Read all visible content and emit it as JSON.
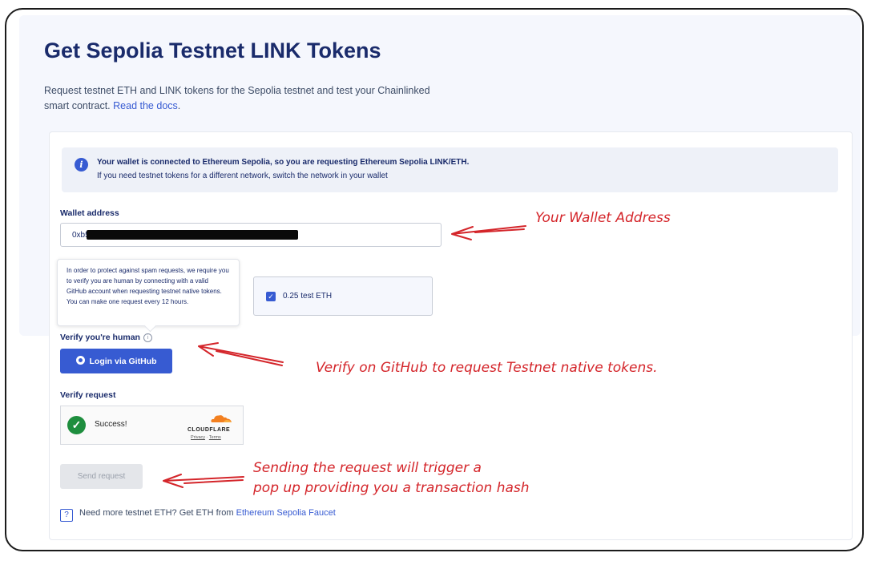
{
  "page": {
    "title": "Get Sepolia Testnet LINK Tokens",
    "subtitle": "Request testnet ETH and LINK tokens for the Sepolia testnet and test your Chainlinked smart contract.",
    "docs_link": "Read the docs"
  },
  "info_box": {
    "icon": "info-icon",
    "line1": "Your wallet is connected to Ethereum Sepolia, so you are requesting Ethereum Sepolia LINK/ETH.",
    "line2": "If you need testnet tokens for a different network, switch the network in your wallet"
  },
  "wallet": {
    "label": "Wallet address",
    "value": "0xb54"
  },
  "tooltip": {
    "text": "In order to protect against spam requests, we require you to verify you are human by connecting with a valid GitHub account when requesting testnet native tokens. You can make one request every 12 hours."
  },
  "eth_option": {
    "label": "0.25 test ETH",
    "checked": true
  },
  "verify_human": {
    "label": "Verify you're human",
    "help_icon": "i",
    "button": "Login via GitHub"
  },
  "verify_request": {
    "label": "Verify request",
    "status": "Success!",
    "brand": "CLOUDFLARE",
    "privacy": "Privacy",
    "terms": "Terms"
  },
  "send": {
    "button": "Send request"
  },
  "faucet": {
    "text": "Need more testnet ETH? Get ETH from",
    "link": "Ethereum Sepolia Faucet"
  },
  "annotations": {
    "wallet": "Your Wallet Address",
    "github": "Verify on GitHub to request Testnet native tokens.",
    "send_line1": "Sending the request will trigger a",
    "send_line2": "pop up providing you a transaction hash"
  },
  "colors": {
    "accent": "#375bd2",
    "annotation": "#d4252a",
    "success": "#1e8e3e"
  }
}
